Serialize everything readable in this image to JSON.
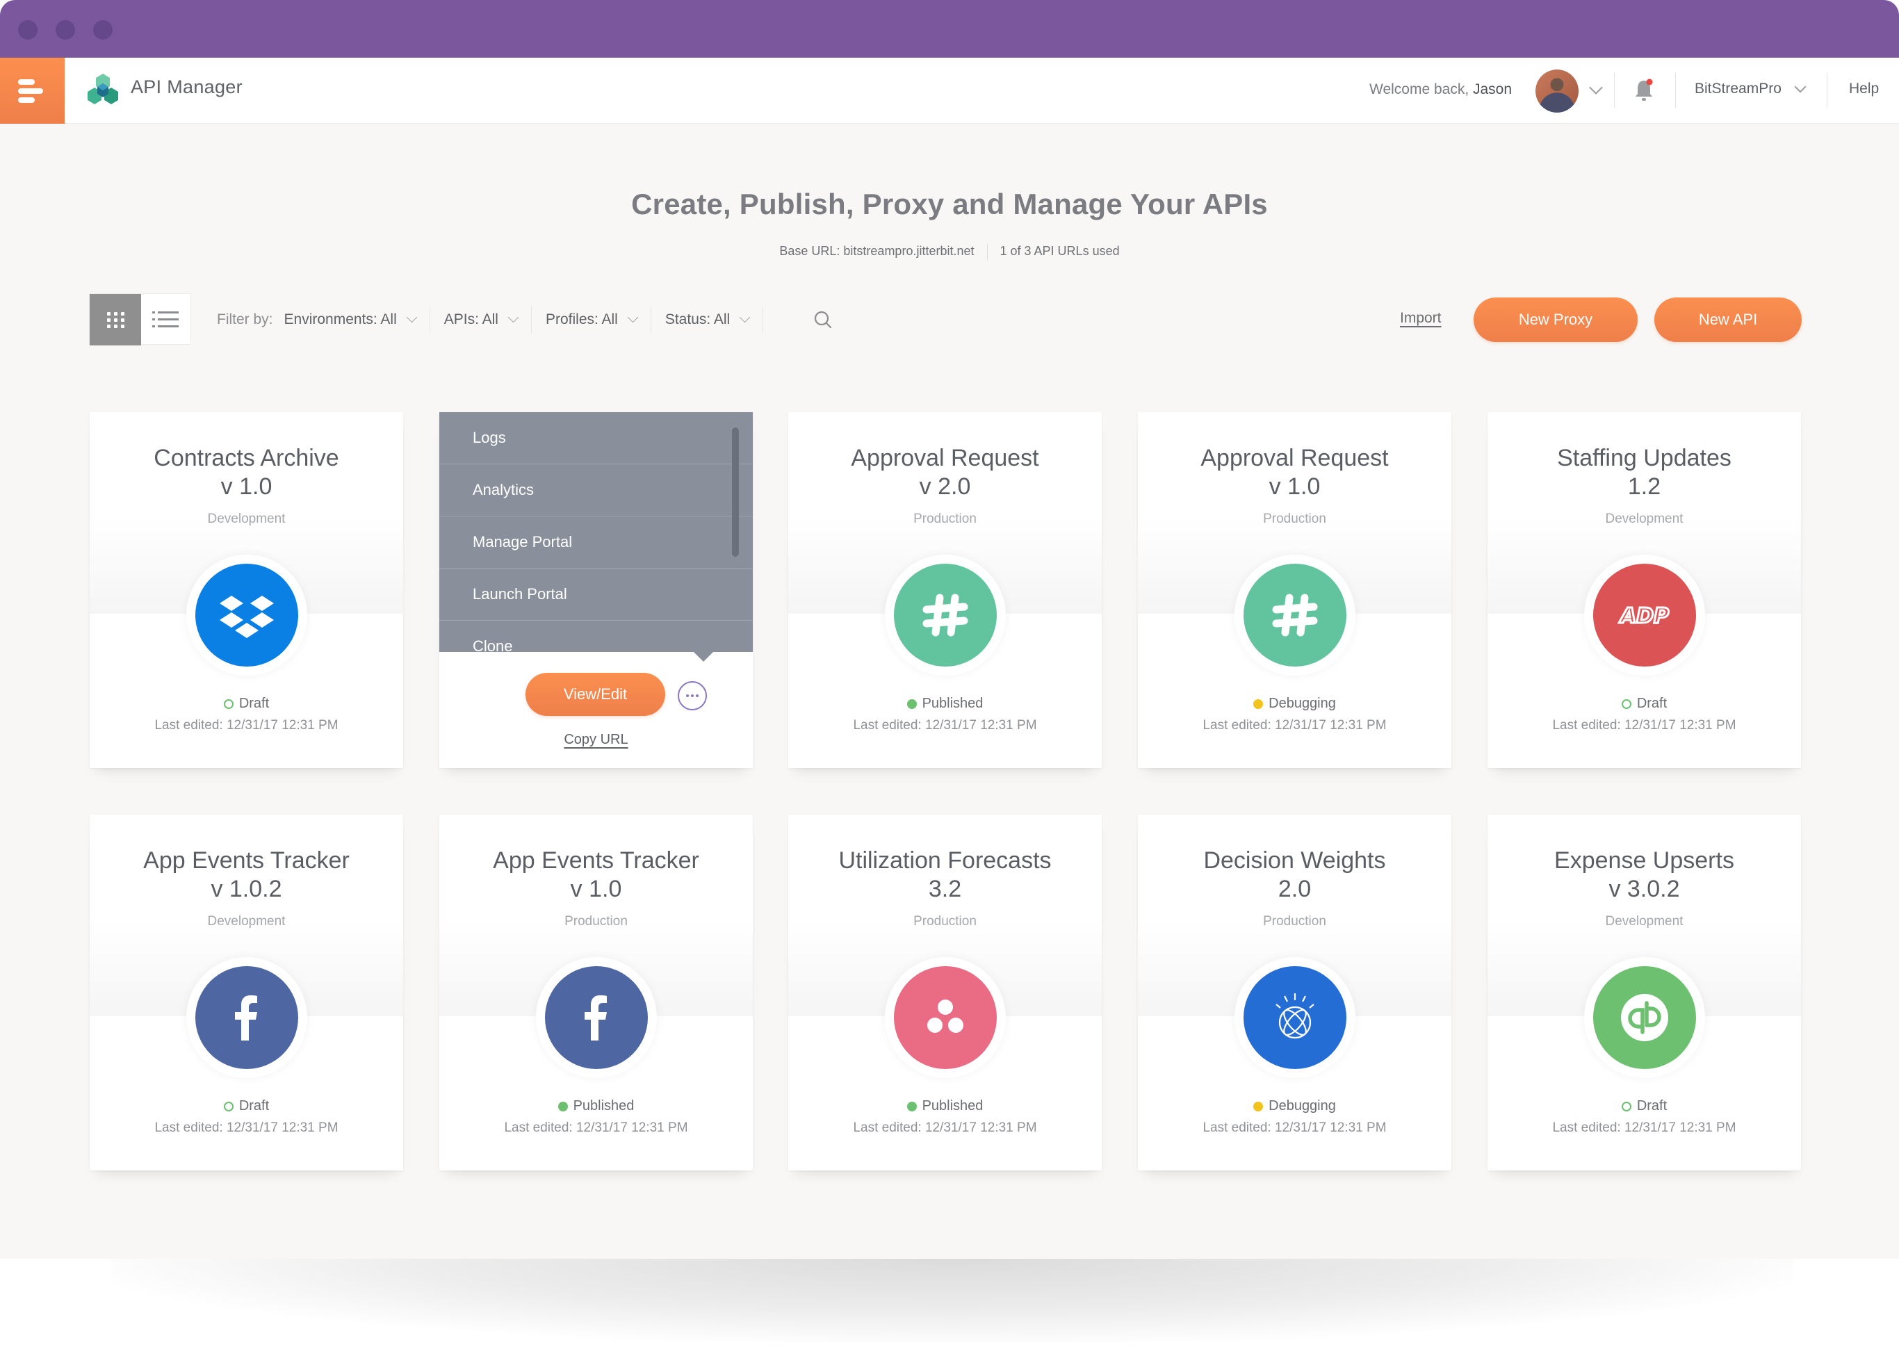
{
  "app": {
    "title": "API Manager",
    "welcome_prefix": "Welcome back, ",
    "user_name": "Jason",
    "org_name": "BitStreamPro",
    "help_label": "Help",
    "notification_badge": true
  },
  "hero": {
    "title": "Create, Publish, Proxy and Manage Your APIs",
    "base_url": "Base URL: bitstreampro.jitterbit.net",
    "usage": "1 of 3 API URLs used"
  },
  "toolbar": {
    "view_modes": [
      {
        "name": "grid",
        "icon": "grid-icon",
        "active": true
      },
      {
        "name": "list",
        "icon": "list-icon",
        "active": false
      }
    ],
    "filter_label": "Filter by:",
    "filters": [
      {
        "label": "Environments: All"
      },
      {
        "label": "APIs: All"
      },
      {
        "label": "Profiles: All"
      },
      {
        "label": "Status: All"
      }
    ],
    "import_label": "Import",
    "new_proxy_label": "New Proxy",
    "new_api_label": "New API"
  },
  "colors": {
    "accent_orange": "#f48a4d",
    "titlebar_purple": "#7b579e",
    "menu_gray": "#8a909b",
    "status_draft": "#6cc070",
    "status_published": "#6cc070",
    "status_debugging": "#f2c31d"
  },
  "card_menu": {
    "items": [
      "Logs",
      "Analytics",
      "Manage Portal",
      "Launch Portal",
      "Clone"
    ],
    "view_edit_label": "View/Edit",
    "copy_url_label": "Copy URL"
  },
  "cards": [
    {
      "name": "Contracts Archive",
      "version": "v 1.0",
      "environment": "Development",
      "status": "Draft",
      "status_style": "hollow",
      "status_color": "#6cc070",
      "last_edited": "Last edited: 12/31/17 12:31 PM",
      "icon": "dropbox-icon",
      "icon_color": "#0a7fe4"
    },
    {
      "name": "",
      "version": "",
      "environment": "",
      "status": "",
      "status_style": "",
      "status_color": "",
      "last_edited": "",
      "icon": "",
      "icon_color": "",
      "menu_open": true
    },
    {
      "name": "Approval Request",
      "version": "v 2.0",
      "environment": "Production",
      "status": "Published",
      "status_style": "solid",
      "status_color": "#6cc070",
      "last_edited": "Last edited: 12/31/17 12:31 PM",
      "icon": "slack-icon",
      "icon_color": "#62c49e"
    },
    {
      "name": "Approval Request",
      "version": "v 1.0",
      "environment": "Production",
      "status": "Debugging",
      "status_style": "solid",
      "status_color": "#f2c31d",
      "last_edited": "Last edited: 12/31/17 12:31 PM",
      "icon": "slack-icon",
      "icon_color": "#62c49e"
    },
    {
      "name": "Staffing Updates",
      "version": "1.2",
      "environment": "Development",
      "status": "Draft",
      "status_style": "hollow",
      "status_color": "#6cc070",
      "last_edited": "Last edited: 12/31/17 12:31 PM",
      "icon": "adp-icon",
      "icon_color": "#dc5356"
    },
    {
      "name": "App Events Tracker",
      "version": "v 1.0.2",
      "environment": "Development",
      "status": "Draft",
      "status_style": "hollow",
      "status_color": "#6cc070",
      "last_edited": "Last edited: 12/31/17 12:31 PM",
      "icon": "facebook-icon",
      "icon_color": "#4e67a3"
    },
    {
      "name": "App Events Tracker",
      "version": "v 1.0",
      "environment": "Production",
      "status": "Published",
      "status_style": "solid",
      "status_color": "#6cc070",
      "last_edited": "Last edited: 12/31/17 12:31 PM",
      "icon": "facebook-icon",
      "icon_color": "#4e67a3"
    },
    {
      "name": "Utilization Forecasts",
      "version": "3.2",
      "environment": "Production",
      "status": "Published",
      "status_style": "solid",
      "status_color": "#6cc070",
      "last_edited": "Last edited: 12/31/17 12:31 PM",
      "icon": "asana-icon",
      "icon_color": "#ea6b84"
    },
    {
      "name": "Decision Weights",
      "version": "2.0",
      "environment": "Production",
      "status": "Debugging",
      "status_style": "solid",
      "status_color": "#f2c31d",
      "last_edited": "Last edited: 12/31/17 12:31 PM",
      "icon": "ibm-watson-icon",
      "icon_color": "#246dd4"
    },
    {
      "name": "Expense Upserts",
      "version": "v 3.0.2",
      "environment": "Development",
      "status": "Draft",
      "status_style": "hollow",
      "status_color": "#6cc070",
      "last_edited": "Last edited: 12/31/17 12:31 PM",
      "icon": "quickbooks-icon",
      "icon_color": "#6cc070"
    }
  ]
}
